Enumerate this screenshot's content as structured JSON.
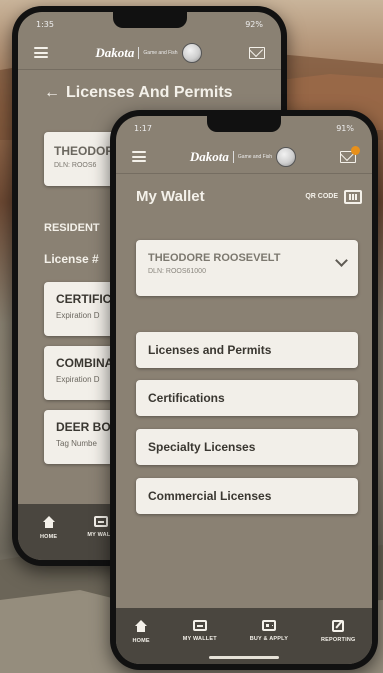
{
  "back_phone": {
    "status_time": "1:35",
    "status_right": "92%",
    "logo_word": "Dakota",
    "logo_sub": "Game and Fish",
    "page_title": "Licenses And Permits",
    "name_partial": "THEODOR",
    "dln_partial": "DLN: ROOS6",
    "resident_label": "RESIDENT",
    "license_label": "License #",
    "items": [
      {
        "title": "CERTIFIC",
        "sub": "Expiration D"
      },
      {
        "title": "COMBINA",
        "sub": "Expiration D"
      },
      {
        "title": "DEER BO",
        "sub": "Tag Numbe"
      }
    ],
    "tabs": [
      {
        "label": "HOME",
        "icon": "home-icon"
      },
      {
        "label": "MY WALL",
        "icon": "wallet-icon"
      }
    ]
  },
  "front_phone": {
    "status_time": "1:17",
    "status_right": "91%",
    "logo_word": "Dakota",
    "logo_sub": "Game and Fish",
    "page_title": "My Wallet",
    "qr_label": "QR CODE",
    "name": "THEODORE ROOSEVELT",
    "dln": "DLN: ROOS61000",
    "menu": [
      {
        "label": "Licenses and Permits"
      },
      {
        "label": "Certifications"
      },
      {
        "label": "Specialty Licenses"
      },
      {
        "label": "Commercial Licenses"
      }
    ],
    "tabs": [
      {
        "label": "HOME",
        "icon": "home-icon"
      },
      {
        "label": "MY WALLET",
        "icon": "wallet-icon"
      },
      {
        "label": "BUY & APPLY",
        "icon": "id-card-icon"
      },
      {
        "label": "REPORTING",
        "icon": "edit-icon"
      }
    ]
  },
  "colors": {
    "screen_bg": "#8a8173",
    "card_bg": "#f2efe9",
    "tabbar_bg": "#4a463f",
    "badge": "#e8901a"
  }
}
